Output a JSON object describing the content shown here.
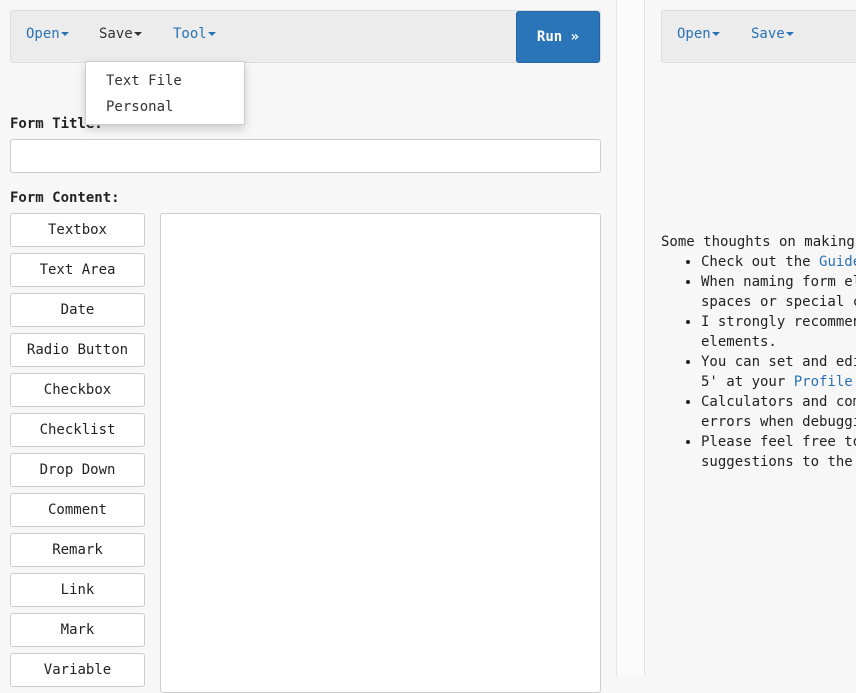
{
  "left": {
    "menu": {
      "open": "Open",
      "save": "Save",
      "tool": "Tool",
      "run": "Run »"
    },
    "save_dropdown": [
      "Text File",
      "Personal"
    ],
    "form_title_label": "Form Title:",
    "form_title_value": "",
    "form_content_label": "Form Content:",
    "elements": [
      "Textbox",
      "Text Area",
      "Date",
      "Radio Button",
      "Checkbox",
      "Checklist",
      "Drop Down",
      "Comment",
      "Remark",
      "Link",
      "Mark",
      "Variable"
    ]
  },
  "right": {
    "menu": {
      "open": "Open",
      "save": "Save"
    },
    "intro": "Some thoughts on making",
    "tips": [
      {
        "pre": "Check out the ",
        "link": "Guide",
        "post": ""
      },
      {
        "pre": "When naming form el",
        "post": " spaces or special c"
      },
      {
        "pre": "I strongly recommen",
        "post": " elements."
      },
      {
        "pre": "You can set and edi",
        "post": " 5' at your ",
        "link": "Profile"
      },
      {
        "pre": "Calculators and com",
        "post": " errors when debuggi"
      },
      {
        "pre": "Please feel free to",
        "post": " suggestions to the"
      }
    ]
  },
  "colors": {
    "accent": "#2a74b8",
    "link": "#2a72b5"
  }
}
